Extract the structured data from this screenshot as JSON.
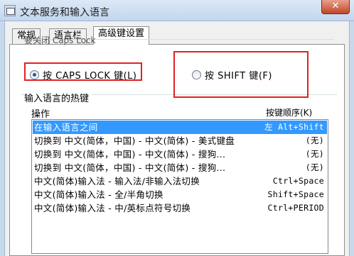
{
  "window": {
    "title": "文本服务和输入语言",
    "close_label": "✕"
  },
  "tabs": [
    {
      "label": "常规"
    },
    {
      "label": "语言栏"
    },
    {
      "label": "高级键设置"
    }
  ],
  "caps_lock": {
    "group_label": "要关闭 Caps Lock",
    "options": [
      {
        "label": "按 CAPS LOCK 键(L)",
        "checked": true
      },
      {
        "label": "按 SHIFT 键(F)",
        "checked": false
      }
    ]
  },
  "hotkeys": {
    "group_label": "输入语言的热键",
    "column_action": "操作",
    "column_key": "按键顺序(K)",
    "rows": [
      {
        "action": "在输入语言之间",
        "key": "左 Alt+Shift",
        "selected": true
      },
      {
        "action": "切换到 中文(简体，中国) - 中文(简体) - 美式键盘",
        "key": "(无)",
        "selected": false
      },
      {
        "action": "切换到 中文(简体，中国) - 中文(简体) - 搜狗...",
        "key": "(无)",
        "selected": false
      },
      {
        "action": "切换到 中文(简体，中国) - 中文(简体) - 搜狗...",
        "key": "(无)",
        "selected": false
      },
      {
        "action": "中文(简体)输入法 - 输入法/非输入法切换",
        "key": "Ctrl+Space",
        "selected": false
      },
      {
        "action": "中文(简体)输入法 - 全/半角切换",
        "key": "Shift+Space",
        "selected": false
      },
      {
        "action": "中文(简体)输入法 - 中/英标点符号切换",
        "key": "Ctrl+PERIOD",
        "selected": false
      }
    ]
  },
  "colors": {
    "highlight": "#e02222",
    "selection": "#3399ff"
  }
}
